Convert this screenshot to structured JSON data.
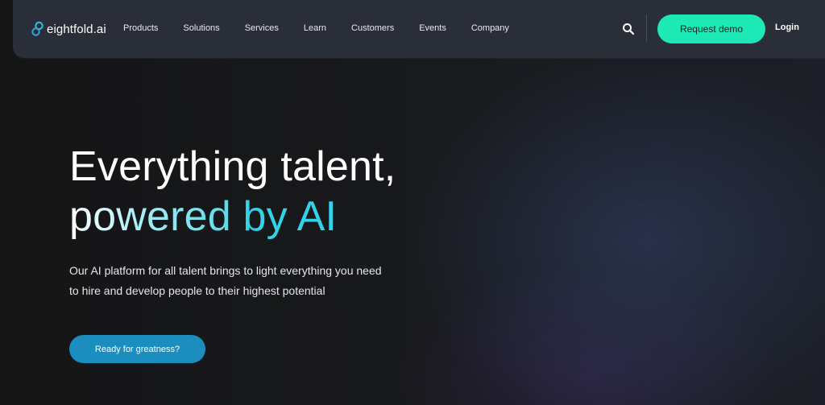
{
  "header": {
    "logo_text": "eightfold.ai",
    "nav": [
      {
        "label": "Products"
      },
      {
        "label": "Solutions"
      },
      {
        "label": "Services"
      },
      {
        "label": "Learn"
      },
      {
        "label": "Customers"
      },
      {
        "label": "Events"
      },
      {
        "label": "Company"
      }
    ],
    "search_icon": "search-icon",
    "demo_button": "Request demo",
    "login": "Login"
  },
  "hero": {
    "title_line1": "Everything talent,",
    "title_line2_part1": "powered ",
    "title_line2_part2": "by AI",
    "subtitle_line1": "Our AI platform for all talent brings to light everything you need",
    "subtitle_line2": "to hire and develop people to their highest potential",
    "cta": "Ready for greatness?"
  },
  "colors": {
    "background": "#141416",
    "nav_background": "#2a2e39",
    "demo_button": "#1de9b6",
    "cta_button": "#1b8dbf",
    "accent": "#32d2e7"
  }
}
